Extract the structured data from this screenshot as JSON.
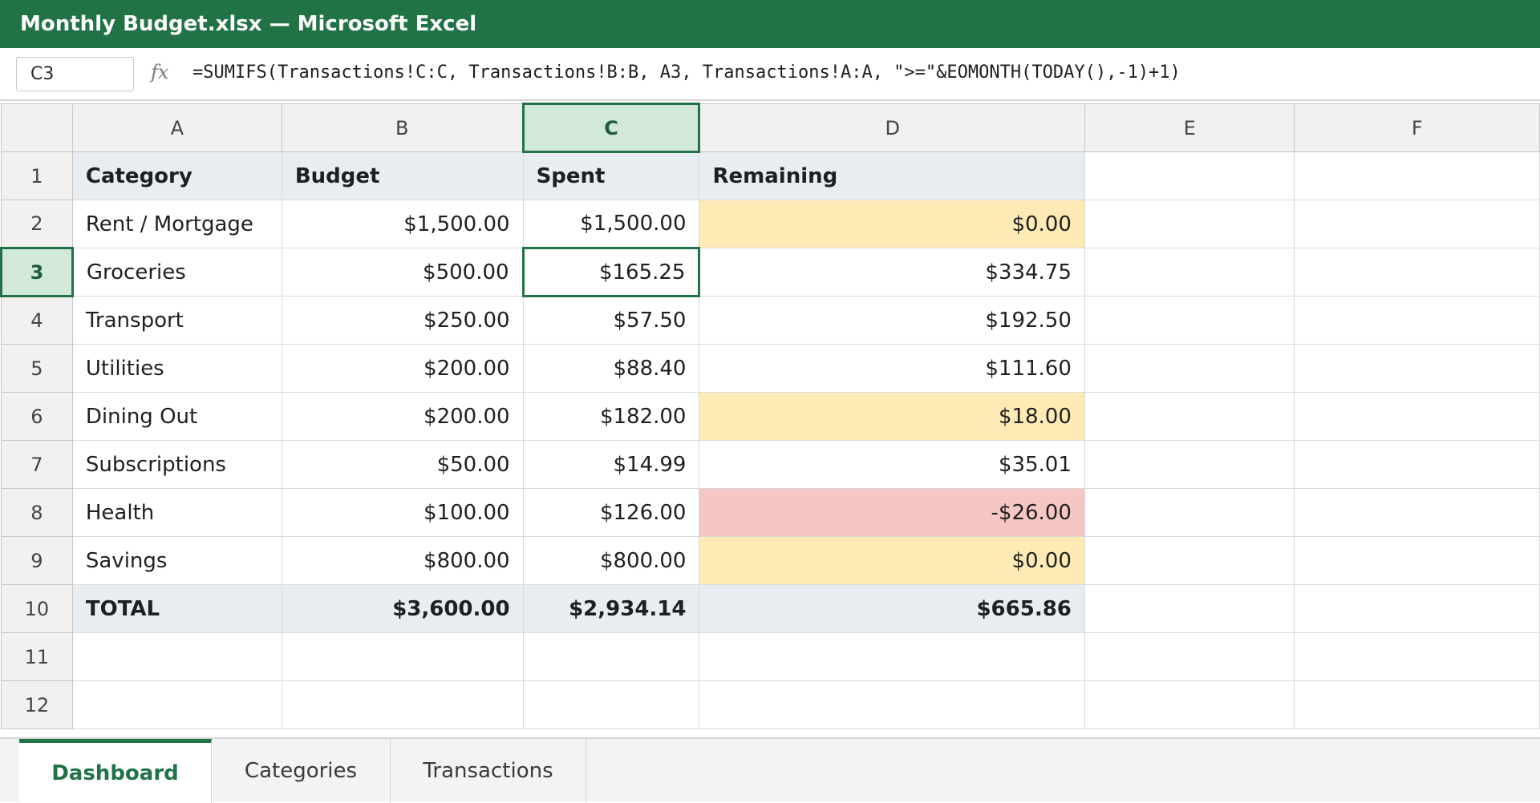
{
  "window": {
    "title": "Monthly Budget.xlsx — Microsoft Excel"
  },
  "formula_bar": {
    "name_box": "C3",
    "fx_label": "fx",
    "formula": "=SUMIFS(Transactions!C:C, Transactions!B:B, A3, Transactions!A:A, \">=\"&EOMONTH(TODAY(),-1)+1)"
  },
  "columns": [
    "A",
    "B",
    "C",
    "D",
    "E",
    "F"
  ],
  "selected_column": "C",
  "selected_row": "3",
  "rows": [
    {
      "n": "1",
      "a": "Category",
      "b": "Budget",
      "c": "Spent",
      "d": "Remaining"
    },
    {
      "n": "2",
      "a": "Rent / Mortgage",
      "b": "$1,500.00",
      "c": "$1,500.00",
      "d": "$0.00"
    },
    {
      "n": "3",
      "a": "Groceries",
      "b": "$500.00",
      "c": "$165.25",
      "d": "$334.75"
    },
    {
      "n": "4",
      "a": "Transport",
      "b": "$250.00",
      "c": "$57.50",
      "d": "$192.50"
    },
    {
      "n": "5",
      "a": "Utilities",
      "b": "$200.00",
      "c": "$88.40",
      "d": "$111.60"
    },
    {
      "n": "6",
      "a": "Dining Out",
      "b": "$200.00",
      "c": "$182.00",
      "d": "$18.00"
    },
    {
      "n": "7",
      "a": "Subscriptions",
      "b": "$50.00",
      "c": "$14.99",
      "d": "$35.01"
    },
    {
      "n": "8",
      "a": "Health",
      "b": "$100.00",
      "c": "$126.00",
      "d": "-$26.00"
    },
    {
      "n": "9",
      "a": "Savings",
      "b": "$800.00",
      "c": "$800.00",
      "d": "$0.00"
    },
    {
      "n": "10",
      "a": "TOTAL",
      "b": "$3,600.00",
      "c": "$2,934.14",
      "d": "$665.86"
    },
    {
      "n": "11",
      "a": "",
      "b": "",
      "c": "",
      "d": ""
    },
    {
      "n": "12",
      "a": "",
      "b": "",
      "c": "",
      "d": ""
    }
  ],
  "colors": {
    "accent": "#217346",
    "header_fill": "#e8edf2",
    "warning_fill": "#fdeab4",
    "over_budget_fill": "#f4c6c4"
  },
  "sheet_tabs": [
    {
      "label": "Dashboard",
      "active": true
    },
    {
      "label": "Categories",
      "active": false
    },
    {
      "label": "Transactions",
      "active": false
    }
  ]
}
